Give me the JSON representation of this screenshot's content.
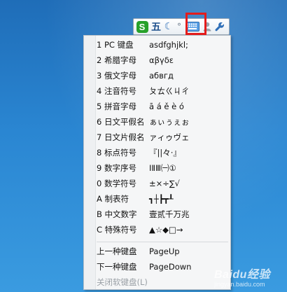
{
  "toolbar": {
    "logo_letter": "S",
    "wubi_label": "五",
    "moon_glyph": "☾",
    "dot_glyph": "°",
    "person_glyph": "●",
    "wrench_glyph": "🔧",
    "highlight_color": "#e41c1c"
  },
  "menu": {
    "items": [
      {
        "label": "1 PC 键盘",
        "sample": "asdfghjkl;"
      },
      {
        "label": "2 希腊字母",
        "sample": "αβγδε"
      },
      {
        "label": "3 俄文字母",
        "sample": "абвгд"
      },
      {
        "label": "4 注音符号",
        "sample": "ㄆㄊㄍㄐㄔ"
      },
      {
        "label": "5 拼音字母",
        "sample": "ā á ě è ó"
      },
      {
        "label": "6 日文平假名",
        "sample": "ぁぃぅぇぉ"
      },
      {
        "label": "7 日文片假名",
        "sample": "ァィゥヴェ"
      },
      {
        "label": "8 标点符号",
        "sample": "『||々·』"
      },
      {
        "label": "9 数字序号",
        "sample": "ⅠⅡⅢ㈠①"
      },
      {
        "label": "0 数学符号",
        "sample": "±×÷∑√"
      },
      {
        "label": "A 制表符",
        "sample": "┓┼┣┳┸"
      },
      {
        "label": "B 中文数字",
        "sample": "壹贰千万兆"
      },
      {
        "label": "C 特殊符号",
        "sample": "▲☆◆□→"
      }
    ],
    "prev_label": "上一种键盘",
    "prev_key": "PageUp",
    "next_label": "下一种键盘",
    "next_key": "PageDown",
    "close_label": "关闭软键盘(L)"
  },
  "watermark": {
    "main": "Baidu经验",
    "sub": "jingyan.baidu.com"
  }
}
